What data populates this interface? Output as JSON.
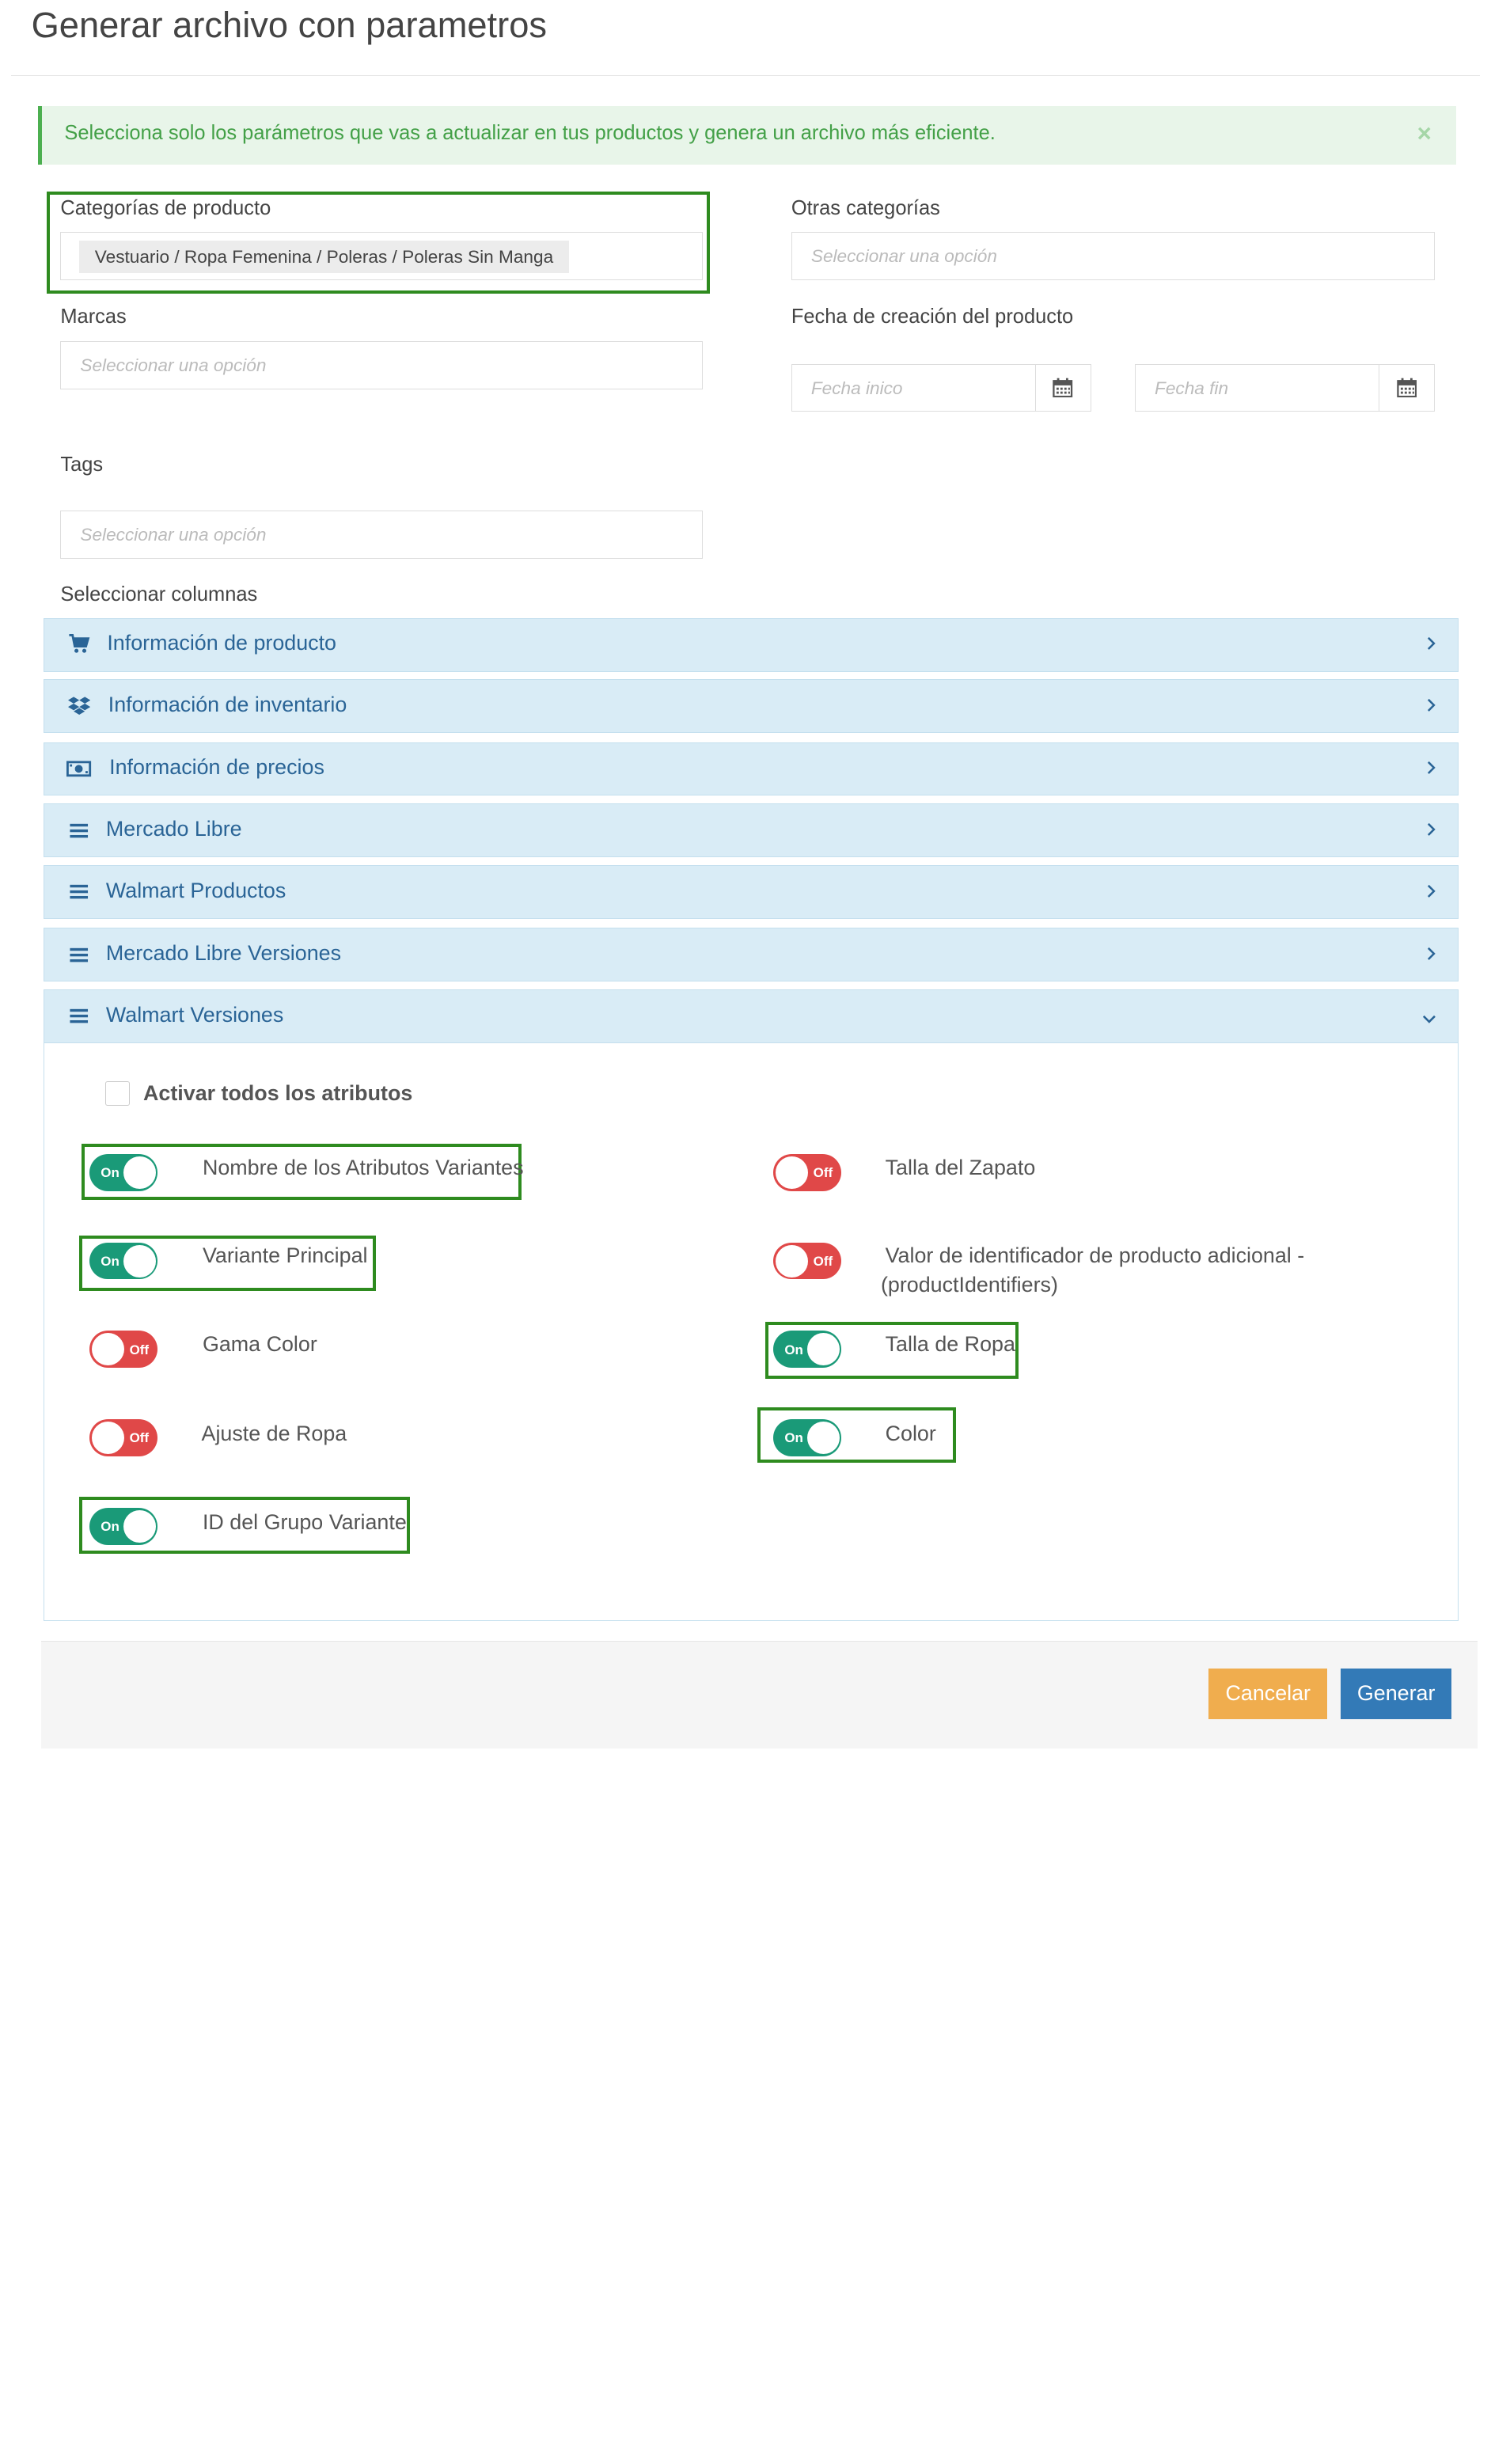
{
  "modal": {
    "title": "Generar archivo con parametros"
  },
  "alert": {
    "text": "Selecciona solo los parámetros que vas a actualizar en tus productos y genera un archivo más eficiente.",
    "close_symbol": "×"
  },
  "filters": {
    "categorias": {
      "label": "Categorías de producto",
      "selected": "Vestuario / Ropa Femenina / Poleras / Poleras Sin Manga"
    },
    "otras": {
      "label": "Otras categorías",
      "placeholder": "Seleccionar una opción"
    },
    "marcas": {
      "label": "Marcas",
      "placeholder": "Seleccionar una opción"
    },
    "fecha": {
      "label": "Fecha de creación del producto",
      "start_placeholder": "Fecha inico",
      "end_placeholder": "Fecha fin",
      "icon": "calendar-icon"
    },
    "tags": {
      "label": "Tags",
      "placeholder": "Seleccionar una opción"
    }
  },
  "columns": {
    "label": "Seleccionar columnas",
    "sections": [
      {
        "title": "Información de producto",
        "icon": "cart-icon",
        "expanded": false
      },
      {
        "title": "Información de inventario",
        "icon": "dropbox-icon",
        "expanded": false
      },
      {
        "title": "Información de precios",
        "icon": "money-icon",
        "expanded": false
      },
      {
        "title": "Mercado Libre",
        "icon": "list-icon",
        "expanded": false
      },
      {
        "title": "Walmart Productos",
        "icon": "list-icon",
        "expanded": false
      },
      {
        "title": "Mercado Libre Versiones",
        "icon": "list-icon",
        "expanded": false
      },
      {
        "title": "Walmart Versiones",
        "icon": "list-icon",
        "expanded": true
      }
    ]
  },
  "walmart_versiones": {
    "activate_all": {
      "label": "Activar todos los atributos",
      "checked": false
    },
    "toggle_on_text": "On",
    "toggle_off_text": "Off",
    "attributes": [
      {
        "name": "Nombre de los Atributos Variantes",
        "on": true
      },
      {
        "name": "Talla del Zapato",
        "on": false
      },
      {
        "name": "Variante Principal",
        "on": true
      },
      {
        "name": "Valor de identificador de producto adicional - (productIdentifiers)",
        "on": false
      },
      {
        "name": "Gama Color",
        "on": false
      },
      {
        "name": "Talla de Ropa",
        "on": true
      },
      {
        "name": "Ajuste de Ropa",
        "on": false
      },
      {
        "name": "Color",
        "on": true
      },
      {
        "name": "ID del Grupo Variante",
        "on": true
      }
    ]
  },
  "footer": {
    "cancel_label": "Cancelar",
    "generate_label": "Generar"
  },
  "colors": {
    "accent_green": "#2e8b1f",
    "toggle_on": "#1a9a78",
    "toggle_off": "#e04848",
    "cancel": "#f0ad4e",
    "generate": "#337ab7",
    "accordion_bg": "#d9ecf6"
  }
}
